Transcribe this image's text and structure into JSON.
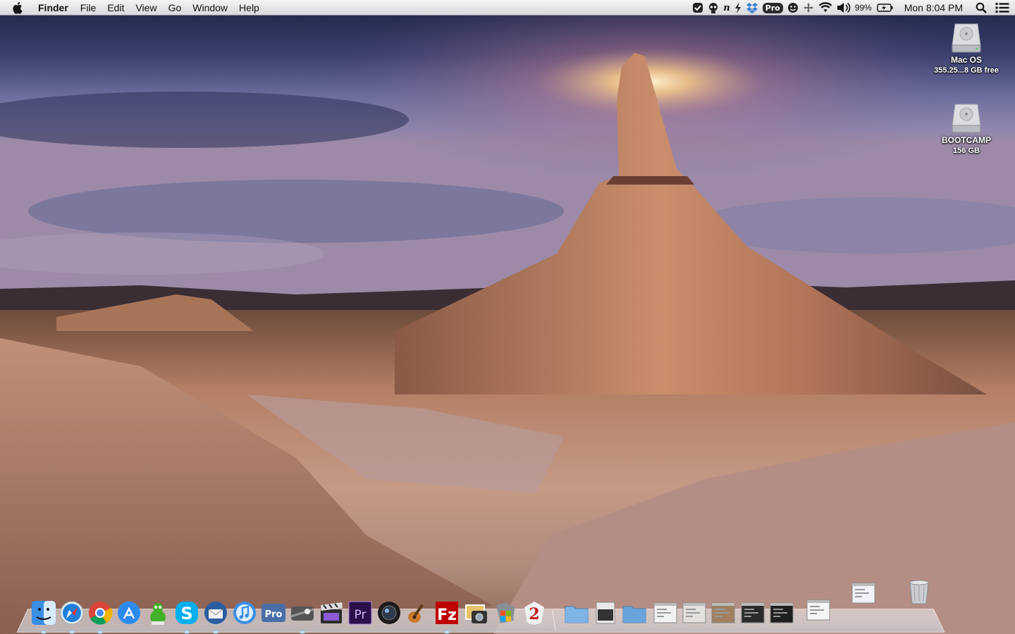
{
  "menubar": {
    "apple_icon": "apple-logo-icon",
    "app_name": "Finder",
    "menus": [
      "File",
      "Edit",
      "View",
      "Go",
      "Window",
      "Help"
    ],
    "status_icons": [
      "cleanmymac-icon",
      "alien-icon",
      "n-icon",
      "bolt-icon",
      "dropbox-icon",
      "pro-badge",
      "smiley-icon",
      "move-icon",
      "wifi-icon",
      "volume-icon"
    ],
    "pro_label": "Pro",
    "battery_percent": "99%",
    "battery_icon": "battery-charging-icon",
    "clock": "Mon 8:04 PM",
    "spotlight_icon": "spotlight-icon",
    "notification_icon": "notification-center-icon"
  },
  "desktop": {
    "drives": [
      {
        "name": "Mac OS",
        "info": "355.25...8 GB free",
        "icon": "hard-drive-icon"
      },
      {
        "name": "BOOTCAMP",
        "info": "156 GB",
        "icon": "hard-drive-icon"
      }
    ]
  },
  "dock": {
    "apps": [
      {
        "name": "Finder",
        "icon": "finder-icon",
        "color": "#3a8ee6"
      },
      {
        "name": "Safari",
        "icon": "safari-icon",
        "color": "#1f7fd9"
      },
      {
        "name": "Chrome",
        "icon": "chrome-icon",
        "color": "#db4437"
      },
      {
        "name": "App Store",
        "icon": "app-store-icon",
        "color": "#2d8bf0"
      },
      {
        "name": "Adium",
        "icon": "adium-duck-icon",
        "color": "#43b02a"
      },
      {
        "name": "Skype",
        "icon": "skype-icon",
        "color": "#00aff0"
      },
      {
        "name": "Thunderbird",
        "icon": "thunderbird-icon",
        "color": "#2a5d9f"
      },
      {
        "name": "iTunes",
        "icon": "itunes-icon",
        "color": "#3b8ee8"
      },
      {
        "name": "Pro",
        "icon": "pro-app-icon",
        "color": "#4a6fa8"
      },
      {
        "name": "Steam",
        "icon": "steam-icon",
        "color": "#3b3b3b"
      },
      {
        "name": "Final Cut Pro",
        "icon": "clapper-icon",
        "color": "#2b2b2b"
      },
      {
        "name": "Premiere",
        "icon": "premiere-icon",
        "color": "#2a0f4a"
      },
      {
        "name": "Aperture",
        "icon": "aperture-lens-icon",
        "color": "#1a1a1a"
      },
      {
        "name": "GarageBand",
        "icon": "guitar-icon",
        "color": "#c77a2e"
      },
      {
        "name": "FileZilla",
        "icon": "filezilla-icon",
        "color": "#bf0000"
      },
      {
        "name": "iPhoto",
        "icon": "iphoto-icon",
        "color": "#6a5a3a"
      },
      {
        "name": "Boot Camp Assistant",
        "icon": "bootcamp-icon",
        "color": "#8a8f96"
      },
      {
        "name": "Guild Wars 2",
        "icon": "guild-wars-2-icon",
        "color": "#c21b1b"
      }
    ],
    "stacks": [
      {
        "name": "Applications",
        "icon": "folder-icon",
        "color": "#7fb4e6"
      },
      {
        "name": "Documents",
        "icon": "documents-stack-icon",
        "color": "#e8e8e8"
      },
      {
        "name": "Downloads",
        "icon": "folder-icon",
        "color": "#6aa3d9"
      },
      {
        "name": "Minimized Skype",
        "icon": "window-thumbnail-icon",
        "color": "#f2f2f2"
      },
      {
        "name": "Minimized Guild Wars",
        "icon": "window-thumbnail-icon",
        "color": "#e4e0dc"
      },
      {
        "name": "Minimized Photo",
        "icon": "window-thumbnail-icon",
        "color": "#a08060"
      },
      {
        "name": "Minimized Tower",
        "icon": "window-thumbnail-icon",
        "color": "#2a2a2a"
      },
      {
        "name": "Minimized Video",
        "icon": "window-thumbnail-icon",
        "color": "#1e1e1e"
      },
      {
        "name": "Minimized Safari",
        "icon": "window-thumbnail-icon",
        "color": "#f5f5f5"
      },
      {
        "name": "Minimized Adium",
        "icon": "window-thumbnail-icon",
        "color": "#f0f4fa"
      },
      {
        "name": "Trash",
        "icon": "trash-icon",
        "color": "#c9ccd0"
      }
    ]
  }
}
